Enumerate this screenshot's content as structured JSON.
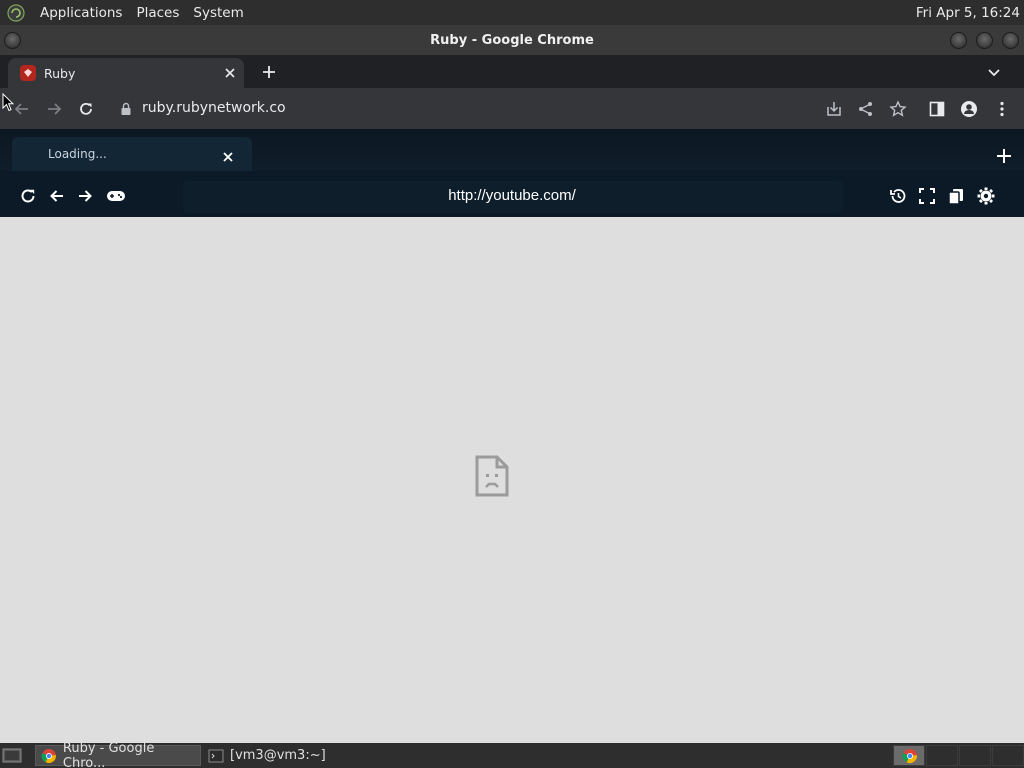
{
  "top_panel": {
    "menus": [
      "Applications",
      "Places",
      "System"
    ],
    "clock": "Fri Apr  5, 16:24"
  },
  "window": {
    "title": "Ruby - Google Chrome"
  },
  "browser": {
    "tab": {
      "title": "Ruby"
    },
    "address": "ruby.rubynetwork.co"
  },
  "proxy": {
    "tab": {
      "title": "Loading..."
    },
    "url": "http://youtube.com/"
  },
  "taskbar": {
    "items": [
      {
        "label": "Ruby - Google Chro...",
        "icon": "chrome-icon",
        "active": true
      },
      {
        "label": "[vm3@vm3:~]",
        "icon": "terminal-icon",
        "active": false
      }
    ]
  },
  "colors": {
    "panel": "#2e2e2e",
    "chrome_frame": "#202124",
    "chrome_toolbar": "#35363a",
    "proxy_bg": "#0b1a26",
    "content_bg": "#dedede",
    "favicon_red": "#b3261e"
  }
}
